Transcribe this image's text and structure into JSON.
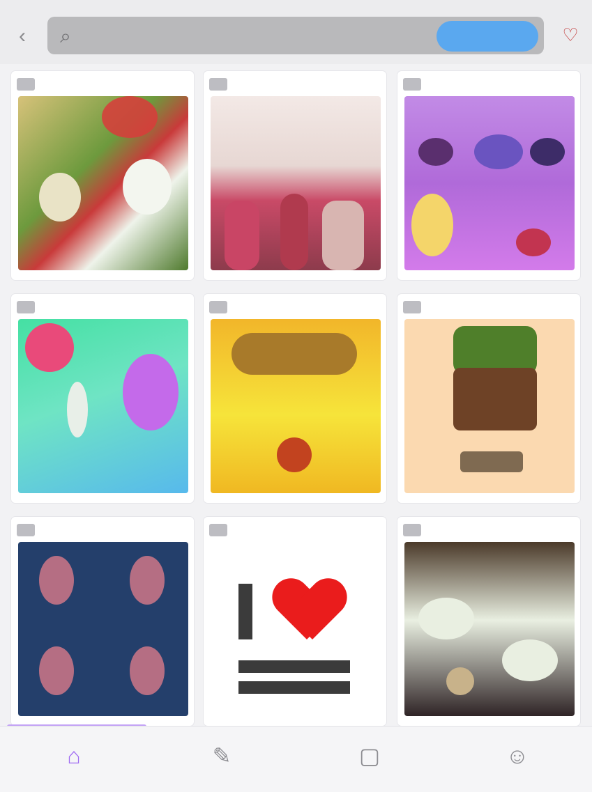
{
  "header": {
    "back_icon": "back-arrow-icon",
    "search_icon": "search-icon",
    "search_placeholder": "",
    "search_button_label": "",
    "notification_icon": "notification-icon"
  },
  "grid": {
    "items": [
      {
        "badge": "",
        "icon": "image-thumb-floral"
      },
      {
        "badge": "",
        "icon": "image-thumb-fashion"
      },
      {
        "badge": "",
        "icon": "image-thumb-purple"
      },
      {
        "badge": "",
        "icon": "image-thumb-balloons"
      },
      {
        "badge": "",
        "icon": "image-thumb-yellow"
      },
      {
        "badge": "",
        "icon": "image-thumb-block"
      },
      {
        "badge": "",
        "icon": "image-thumb-pattern"
      },
      {
        "badge": "",
        "icon": "image-thumb-i-love"
      },
      {
        "badge": "",
        "icon": "image-thumb-dark"
      }
    ]
  },
  "tabbar": {
    "tabs": [
      {
        "label": "",
        "icon": "home-icon",
        "active": true
      },
      {
        "label": "",
        "icon": "brush-icon",
        "active": false
      },
      {
        "label": "",
        "icon": "bag-icon",
        "active": false
      },
      {
        "label": "",
        "icon": "profile-icon",
        "active": false
      }
    ]
  },
  "colors": {
    "accent": "#a06cf2",
    "search_button": "#5aa8ef",
    "background": "#f2f2f4"
  }
}
